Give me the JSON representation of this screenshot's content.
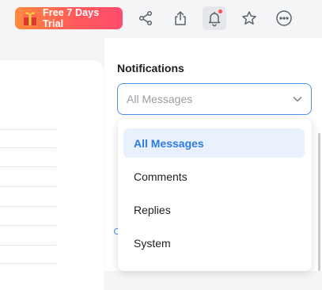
{
  "toolbar": {
    "trial_label": "Free 7 Days Trial",
    "icons": [
      "gift-icon",
      "share-icon",
      "upload-icon",
      "bell-icon",
      "star-icon",
      "more-icon"
    ],
    "bell_has_badge": true
  },
  "notifications": {
    "title": "Notifications",
    "select_value": "All Messages",
    "options": [
      {
        "label": "All Messages",
        "selected": true
      },
      {
        "label": "Comments",
        "selected": false
      },
      {
        "label": "Replies",
        "selected": false
      },
      {
        "label": "System",
        "selected": false
      }
    ]
  },
  "colors": {
    "accent": "#2d7be5",
    "trial_gradient_start": "#ff8a3c",
    "trial_gradient_end": "#ff4d6d",
    "badge": "#ff4d4f",
    "selected_bg": "#e8f1fc"
  }
}
